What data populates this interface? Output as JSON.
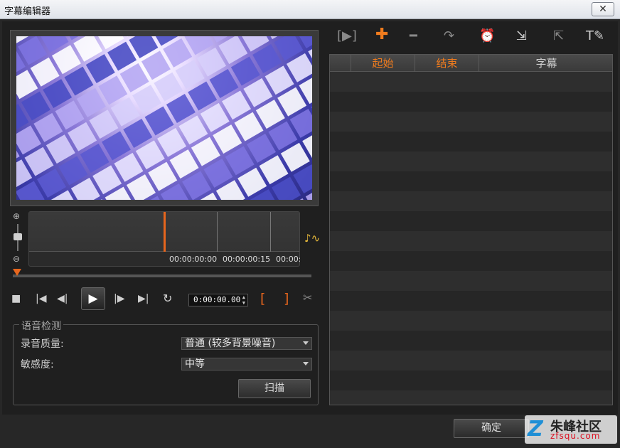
{
  "window": {
    "title": "字幕编辑器",
    "close_icon": "close-icon"
  },
  "timeline": {
    "labels": [
      "00:00:00:00",
      "00:00:00:15",
      "00:00:0"
    ]
  },
  "transport": {
    "timecode": "0:00:00.00",
    "mark_in": "[",
    "mark_out": "]"
  },
  "voice_detection": {
    "title": "语音检测",
    "quality_label": "录音质量:",
    "quality_value": "普通 (较多背景噪音)",
    "sensitivity_label": "敏感度:",
    "sensitivity_value": "中等",
    "scan_label": "扫描"
  },
  "subtitle_table": {
    "columns": [
      "",
      "起始",
      "结束",
      "字幕"
    ],
    "rows": []
  },
  "footer": {
    "ok_label": "确定"
  },
  "watermark": {
    "name": "朱峰社区",
    "url": "zfsqu.com"
  },
  "colors": {
    "accent": "#f07c1e",
    "background": "#1f1f1f",
    "panel": "#2a2a2a"
  }
}
